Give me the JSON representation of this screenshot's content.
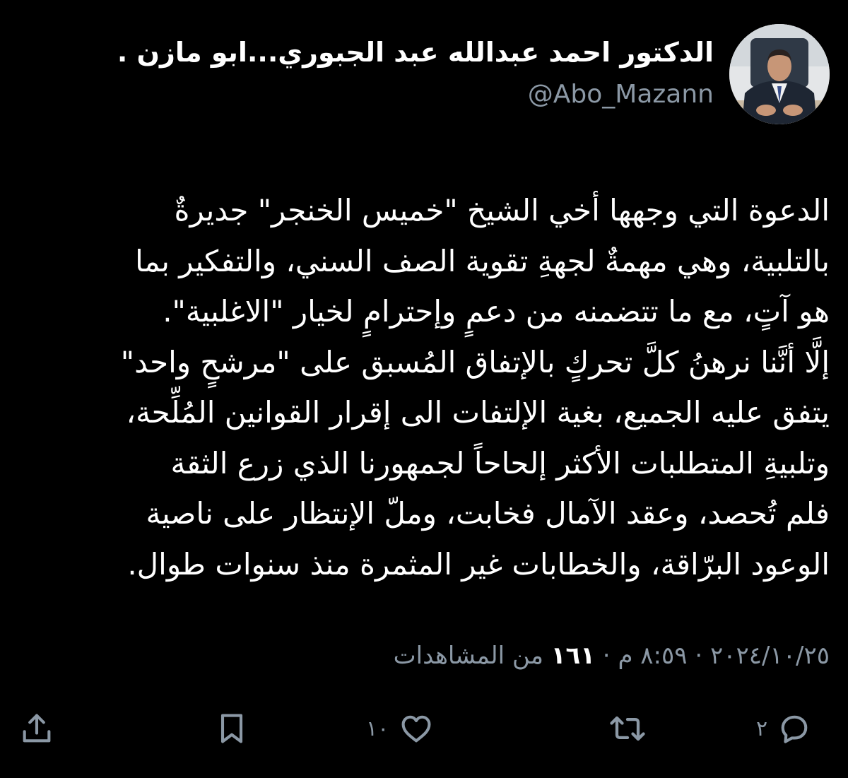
{
  "author": {
    "display_name": "الدكتور احمد عبدالله عبد الجبوري...ابو مازن .",
    "handle": "@Abo_Mazann"
  },
  "tweet": {
    "lines": [
      "الدعوة التي وجهها أخي الشيخ \"خميس الخنجر\" جديرةٌ",
      "بالتلبية، وهي مهمةٌ لجهةِ تقوية الصف السني، والتفكير بما",
      "هو آتٍ، مع ما تتضمنه من دعمٍ وإحترامٍ لخيار \"الاغلبية\".",
      "إلَّا أنَّنا نرهنُ كلَّ تحركٍ بالإتفاق المُسبق على \"مرشحٍ واحد\"",
      "يتفق عليه الجميع، بغية الإلتفات الى إقرار القوانين المُلِّحة،",
      "وتلبيةِ المتطلبات الأكثر إلحاحاً لجمهورنا الذي زرع الثقة",
      "فلم تُحصد، وعقد الآمال فخابت، وملّ الإنتظار على ناصية",
      "الوعود البرّاقة، والخطابات غير المثمرة منذ سنوات طوال."
    ]
  },
  "meta": {
    "date": "٢٠٢٤/١٠/٢٥",
    "separator": " · ",
    "time": "٨:٥٩ م",
    "views_count": "١٦١",
    "views_label": " من المشاهدات"
  },
  "actions": {
    "reply_count": "٢",
    "retweet_count": "",
    "like_count": "١٠"
  },
  "colors": {
    "background": "#000000",
    "text_primary": "#ffffff",
    "text_secondary": "#8b98a5"
  }
}
